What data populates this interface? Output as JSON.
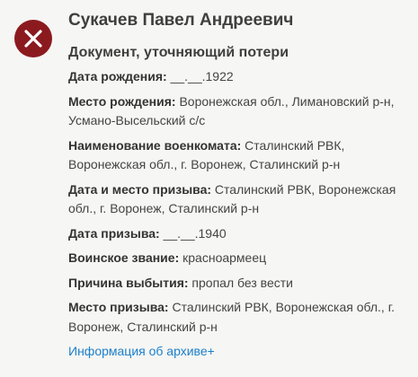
{
  "status_icon": "close-icon",
  "accent_color": "#8b1a1f",
  "link_color": "#1c7fcb",
  "person": {
    "name": "Сукачев Павел Андреевич",
    "document_type": "Документ, уточняющий потери"
  },
  "fields": [
    {
      "label": "Дата рождения:",
      "value": " __.__.1922"
    },
    {
      "label": "Место рождения:",
      "value": " Воронежская обл., Лимановский р-н, Усмано-Высельский с/с"
    },
    {
      "label": "Наименование военкомата:",
      "value": " Сталинский РВК, Воронежская обл., г. Воронеж, Сталинский р-н"
    },
    {
      "label": "Дата и место призыва:",
      "value": " Сталинский РВК, Воронежская обл., г. Воронеж, Сталинский р-н"
    },
    {
      "label": "Дата призыва:",
      "value": " __.__.1940"
    },
    {
      "label": "Воинское звание:",
      "value": " красноармеец"
    },
    {
      "label": "Причина выбытия:",
      "value": " пропал без вести"
    },
    {
      "label": "Место призыва:",
      "value": " Сталинский РВК, Воронежская обл., г. Воронеж, Сталинский р-н"
    }
  ],
  "archive_link": "Информация об архиве+"
}
